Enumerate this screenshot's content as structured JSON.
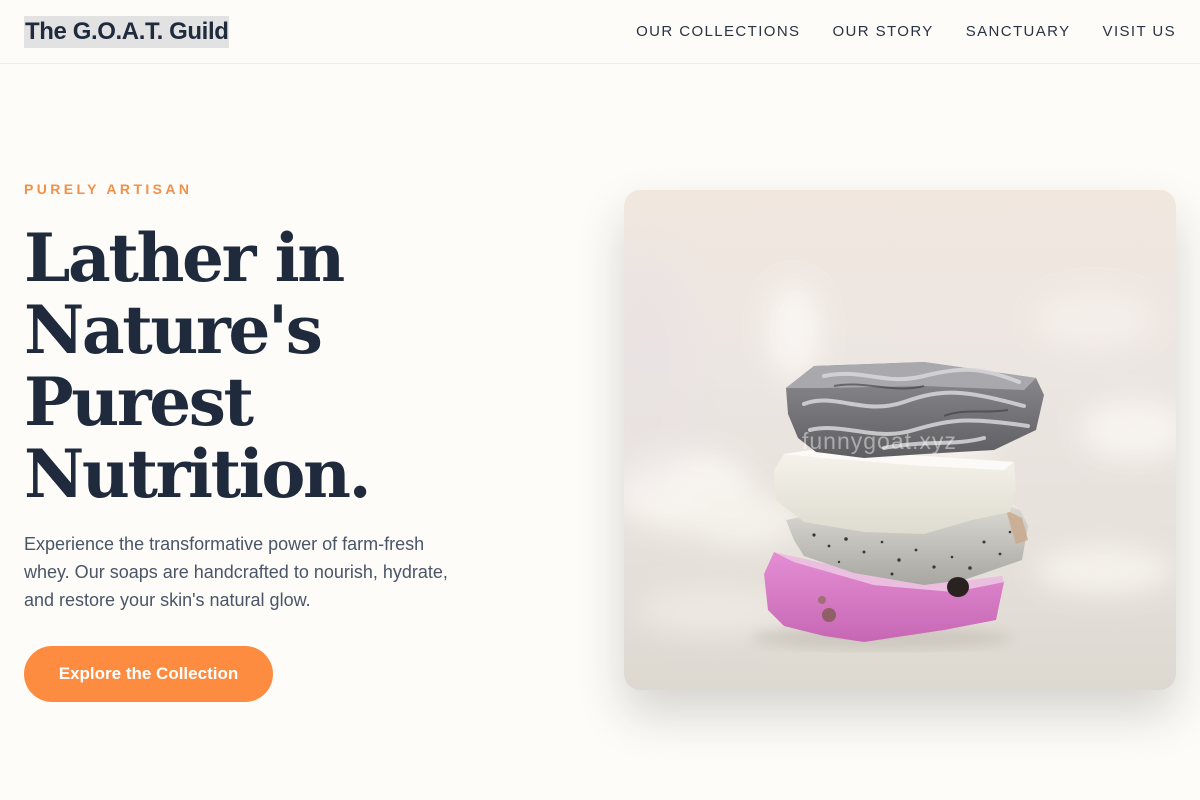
{
  "header": {
    "brand": "The G.O.A.T. Guild",
    "nav": [
      "OUR COLLECTIONS",
      "OUR STORY",
      "SANCTUARY",
      "VISIT US"
    ]
  },
  "hero": {
    "eyebrow": "PURELY ARTISAN",
    "title_lines": [
      "Lather in",
      "Nature's",
      "Purest",
      "Nutrition."
    ],
    "body": "Experience the transformative power of farm-fresh whey. Our soaps are handcrafted to nourish, hydrate, and restore your skin's natural glow.",
    "cta": "Explore the Collection",
    "image_watermark": "funnygoat.xyz"
  },
  "colors": {
    "accent": "#fd8c40",
    "eyebrow": "#f0914a",
    "heading": "#1f2a3d",
    "body_text": "#4a5568",
    "background": "#fdfcf8"
  }
}
